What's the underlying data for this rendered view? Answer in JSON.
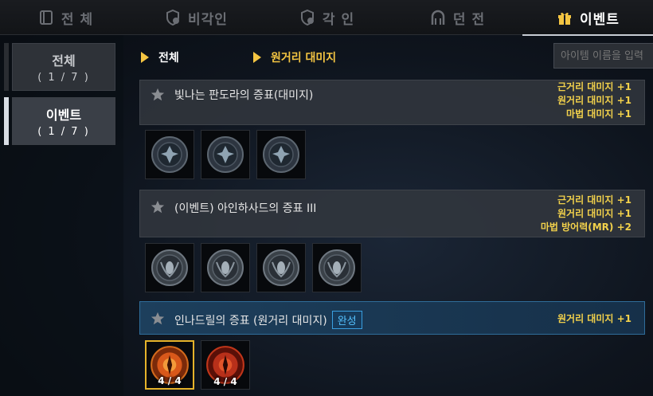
{
  "tabs": [
    {
      "label": "전 체",
      "icon": "book-icon",
      "active": false
    },
    {
      "label": "비각인",
      "icon": "shield-lock-icon",
      "active": false
    },
    {
      "label": "각 인",
      "icon": "shield-info-icon",
      "active": false
    },
    {
      "label": "던 전",
      "icon": "dungeon-gate-icon",
      "active": false
    },
    {
      "label": "이벤트",
      "icon": "gift-icon",
      "active": true
    }
  ],
  "sidebar": {
    "items": [
      {
        "label": "전체",
        "count": "( 1 / 7 )",
        "active": false
      },
      {
        "label": "이벤트",
        "count": "( 1 / 7 )",
        "active": true
      }
    ]
  },
  "breadcrumb": {
    "first": "전체",
    "second": "원거리 대미지"
  },
  "search": {
    "placeholder": "아이템 이름을 입력"
  },
  "sets": [
    {
      "name": "빛나는 판도라의 증표(대미지)",
      "complete": false,
      "effects": [
        "근거리 대미지 +1",
        "원거리 대미지 +1",
        "마법 대미지 +1"
      ],
      "items": [
        {
          "icon": "pandora-coin-icon"
        },
        {
          "icon": "pandora-coin-icon"
        },
        {
          "icon": "pandora-coin-icon"
        }
      ]
    },
    {
      "name": "(이벤트) 아인하사드의 증표 III",
      "complete": false,
      "effects": [
        "근거리 대미지 +1",
        "원거리 대미지 +1",
        "마법 방어력(MR) +2"
      ],
      "items": [
        {
          "icon": "einhasad-coin-icon"
        },
        {
          "icon": "einhasad-coin-icon"
        },
        {
          "icon": "einhasad-coin-icon"
        },
        {
          "icon": "einhasad-coin-icon"
        }
      ]
    },
    {
      "name": "인나드릴의 증표 (원거리 대미지)",
      "badge": "완성",
      "complete": true,
      "effects": [
        "원거리 대미지 +1"
      ],
      "items": [
        {
          "icon": "innadril-emblem-icon",
          "count": "4 / 4",
          "selected": true
        },
        {
          "icon": "innadril-emblem-icon",
          "count": "4 / 4",
          "selected": false
        }
      ]
    }
  ],
  "colors": {
    "accent_gold": "#f4c542",
    "effect_text": "#f2d14b",
    "complete_badge": "#55c2ff"
  }
}
